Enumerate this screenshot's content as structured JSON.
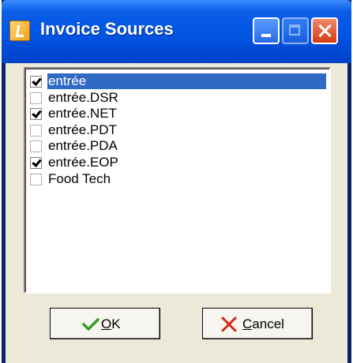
{
  "window": {
    "title": "Invoice Sources"
  },
  "list": {
    "items": [
      {
        "label": "entrée",
        "checked": true,
        "selected": true
      },
      {
        "label": "entrée.DSR",
        "checked": false,
        "selected": false
      },
      {
        "label": "entrée.NET",
        "checked": true,
        "selected": false
      },
      {
        "label": "entrée.PDT",
        "checked": false,
        "selected": false
      },
      {
        "label": "entrée.PDA",
        "checked": false,
        "selected": false
      },
      {
        "label": "entrée.EOP",
        "checked": true,
        "selected": false
      },
      {
        "label": "Food Tech",
        "checked": false,
        "selected": false
      }
    ]
  },
  "buttons": {
    "ok": {
      "mnemonic": "O",
      "rest": "K",
      "icon": "checkmark-icon",
      "icon_color": "#3a9a2a"
    },
    "cancel": {
      "mnemonic": "C",
      "rest": "ancel",
      "icon": "x-icon",
      "icon_color": "#d8261b"
    }
  },
  "colors": {
    "title_bar": "#0054e3",
    "selection": "#316ac5",
    "dialog_bg": "#ece9d8"
  }
}
